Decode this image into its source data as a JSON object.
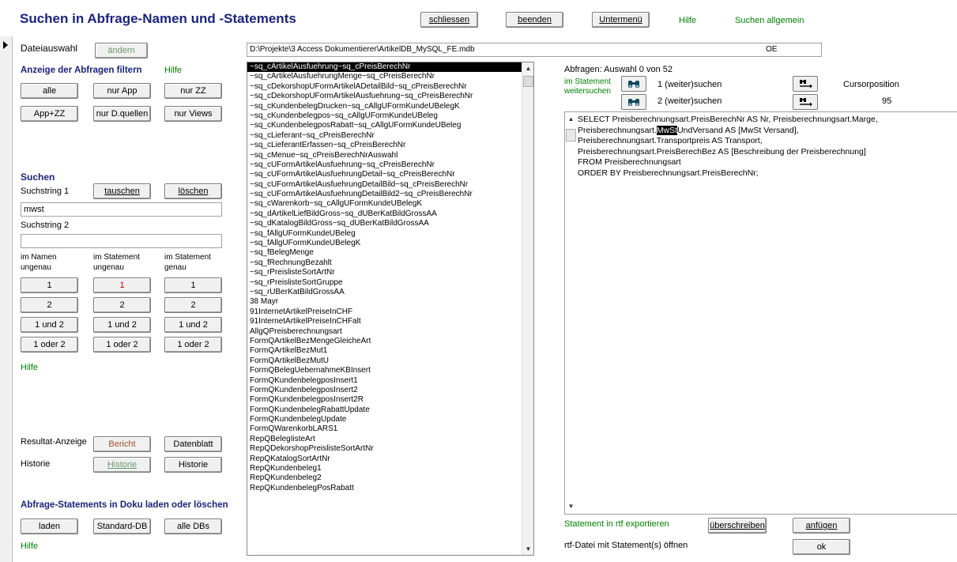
{
  "header": {
    "title": "Suchen in Abfrage-Namen und -Statements",
    "btn_schliessen": "schliessen",
    "btn_beenden": "beenden",
    "btn_untermenu": "Untermenü",
    "link_hilfe": "Hilfe",
    "link_suchen_allgemein": "Suchen allgemein"
  },
  "left": {
    "dateiauswahl_label": "Dateiauswahl",
    "btn_aendern": "ändern",
    "filter_title": "Anzeige der Abfragen filtern",
    "filter_hilfe": "Hilfe",
    "btn_alle": "alle",
    "btn_nur_app": "nur App",
    "btn_nur_zz": "nur ZZ",
    "btn_app_zz": "App+ZZ",
    "btn_nur_dquellen": "nur D.quellen",
    "btn_nur_views": "nur Views",
    "suchen_title": "Suchen",
    "suchstring1_label": "Suchstring 1",
    "btn_tauschen": "tauschen",
    "btn_loeschen": "löschen",
    "suchstring1_value": "mwst",
    "suchstring2_label": "Suchstring 2",
    "suchstring2_value": "",
    "col1_h1": "im Namen",
    "col1_h2": "ungenau",
    "col2_h1": "im Statement",
    "col2_h2": "ungenau",
    "col3_h1": "im Statement",
    "col3_h2": "genau",
    "btn_1": "1",
    "btn_2": "2",
    "btn_1und2": "1 und 2",
    "btn_1oder2": "1 oder 2",
    "suchen_hilfe": "Hilfe",
    "resultat_label": "Resultat-Anzeige",
    "btn_bericht": "Bericht",
    "btn_datenblatt": "Datenblatt",
    "historie_label": "Historie",
    "btn_historie1": "Historie",
    "btn_historie2": "Historie",
    "doku_title": "Abfrage-Statements in Doku laden oder löschen",
    "btn_laden": "laden",
    "btn_standard_db": "Standard-DB",
    "btn_alle_dbs": "alle DBs",
    "doku_hilfe": "Hilfe"
  },
  "file": {
    "path": "D:\\Projekte\\3 Access Dokumentierer\\ArtikelDB_MySQL_FE.mdb",
    "tag": "OE"
  },
  "list": {
    "items": [
      "~sq_cArtikelAusfuehrung~sq_cPreisBerechNr",
      "~sq_cArtikelAusfuehrungMenge~sq_cPreisBerechNr",
      "~sq_cDekorshopUFormArtikelADetailBild~sq_cPreisBerechNr",
      "~sq_cDekorshopUFormArtikelAusfuehrung~sq_cPreisBerechNr",
      "~sq_cKundenbelegDrucken~sq_cAllgUFormKundeUBelegK",
      "~sq_cKundenbelegpos~sq_cAllgUFormKundeUBeleg",
      "~sq_cKundenbelegposRabatt~sq_cAllgUFormKundeUBeleg",
      "~sq_cLieferant~sq_cPreisBerechNr",
      "~sq_cLieferantErfassen~sq_cPreisBerechNr",
      "~sq_cMenue~sq_cPreisBerechNrAuswahl",
      "~sq_cUFormArtikelAusfuehrung~sq_cPreisBerechNr",
      "~sq_cUFormArtikelAusfuehrungDetail~sq_cPreisBerechNr",
      "~sq_cUFormArtikelAusfuehrungDetailBild~sq_cPreisBerechNr",
      "~sq_cUFormArtikelAusfuehrungDetailBild2~sq_cPreisBerechNr",
      "~sq_cWarenkorb~sq_cAllgUFormKundeUBelegK",
      "~sq_dArtikelLiefBildGross~sq_dUBerKatBildGrossAA",
      "~sq_dKatalogBildGross~sq_dUBerKatBildGrossAA",
      "~sq_fAllgUFormKundeUBeleg",
      "~sq_fAllgUFormKundeUBelegK",
      "~sq_fBelegMenge",
      "~sq_fRechnungBezahlt",
      "~sq_rPreislisteSortArtNr",
      "~sq_rPreislisteSortGruppe",
      "~sq_rUBerKatBildGrossAA",
      "38 Mayr",
      "91InternetArtikelPreiseInCHF",
      "91InternetArtikelPreiseInCHFalt",
      "AllgQPreisberechnungsart",
      "FormQArtikelBezMengeGleicheArt",
      "FormQArtikelBezMut1",
      "FormQArtikelBezMutU",
      "FormQBelegUebernahmeKBInsert",
      "FormQKundenbelegposInsert1",
      "FormQKundenbelegposInsert2",
      "FormQKundenbelegposInsert2R",
      "FormQKundenbelegRabattUpdate",
      "FormQKundenbelegUpdate",
      "FormQWarenkorbLARS1",
      "RepQBelegIisteArt",
      "RepQDekorshopPreislisteSortArtNr",
      "RepQKatalogSortArtNr",
      "RepQKundenbeleg1",
      "RepQKundenbeleg2",
      "RepQKundenbelegPosRabatt"
    ]
  },
  "right": {
    "abfragen_info": "Abfragen: Auswahl 0 von 52",
    "im_statement_l1": "im Statement",
    "im_statement_l2": "weitersuchen",
    "search1_label": "1 (weiter)suchen",
    "search2_label": "2 (weiter)suchen",
    "cursor_label": "Cursorposition",
    "cursor_value": "95",
    "statement_before": "SELECT Preisberechnungsart.PreisBerechNr AS Nr, Preisberechnungsart.Marge,\nPreisberechnungsart.",
    "statement_highlight": "MwSt",
    "statement_after": "UndVersand AS [MwSt Versand],\nPreisberechnungsart.Transportpreis AS Transport,\nPreisberechnungsart.PreisBerechBez AS [Beschreibung der Preisberechnung]\nFROM Preisberechnungsart\nORDER BY Preisberechnungsart.PreisBerechNr;",
    "rtf_export_label": "Statement in rtf exportieren",
    "btn_ueberschreiben": "überschreiben",
    "btn_anfuegen": "anfügen",
    "rtf_open_label": "rtf-Datei mit Statement(s) öffnen",
    "btn_ok": "ok"
  },
  "colors": {
    "title": "#1a237e",
    "hilfe": "#008000",
    "selection": "#000000"
  }
}
